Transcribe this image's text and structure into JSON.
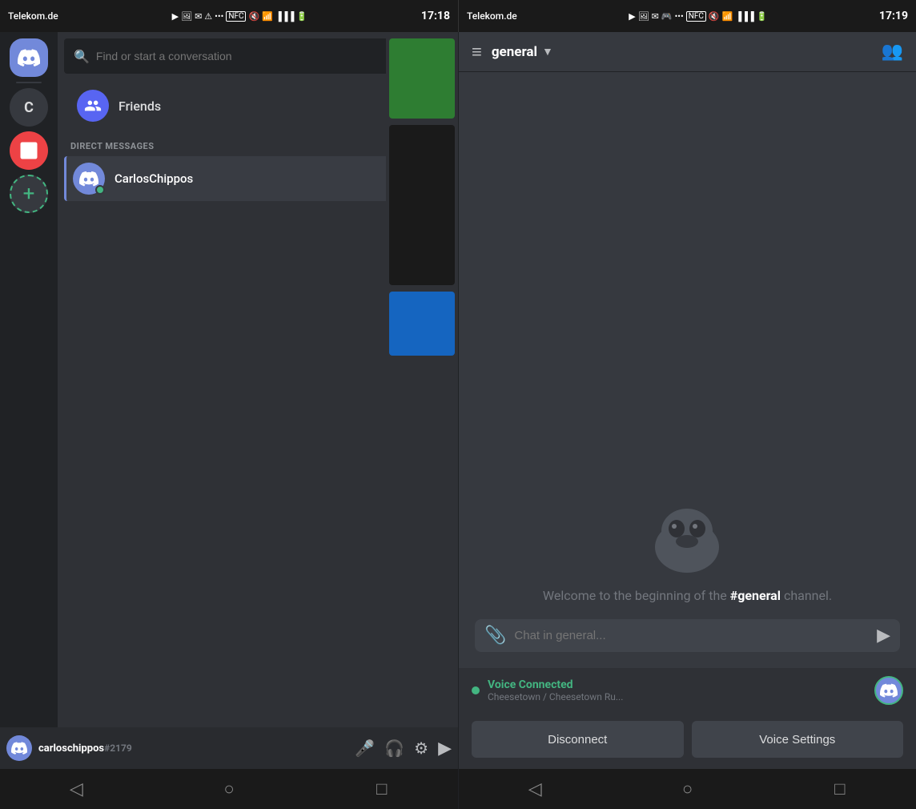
{
  "status_bar_left": {
    "carrier": "Telekom.de",
    "time": "17:18",
    "icons": "▶ 📷 ✉ ⚠ … NFC 🔇 📶 📶 🔋"
  },
  "status_bar_right": {
    "carrier": "Telekom.de",
    "time": "17:19",
    "icons": "▶ 📷 ✉ 🎮 … NFC 🔇 📶 📶 🔋"
  },
  "left_panel": {
    "search_placeholder": "Find or start a conversation",
    "friends_label": "Friends",
    "dm_section_label": "DIRECT MESSAGES",
    "dm_user": {
      "name": "CarlosChippos",
      "status": "online"
    },
    "user_bar": {
      "username": "carloschippos",
      "tag": "#2179"
    }
  },
  "right_panel": {
    "channel_name": "general",
    "welcome_text_prefix": "Welcome to the beginning of the ",
    "welcome_channel": "#general",
    "welcome_text_suffix": " channel.",
    "chat_placeholder": "Chat in general...",
    "voice_connected_label": "Voice Connected",
    "voice_channel_name": "Cheesetown / Cheesetown Ru...",
    "disconnect_label": "Disconnect",
    "voice_settings_label": "Voice Settings"
  },
  "nav_icons": {
    "back": "◁",
    "home": "○",
    "square": "□"
  }
}
